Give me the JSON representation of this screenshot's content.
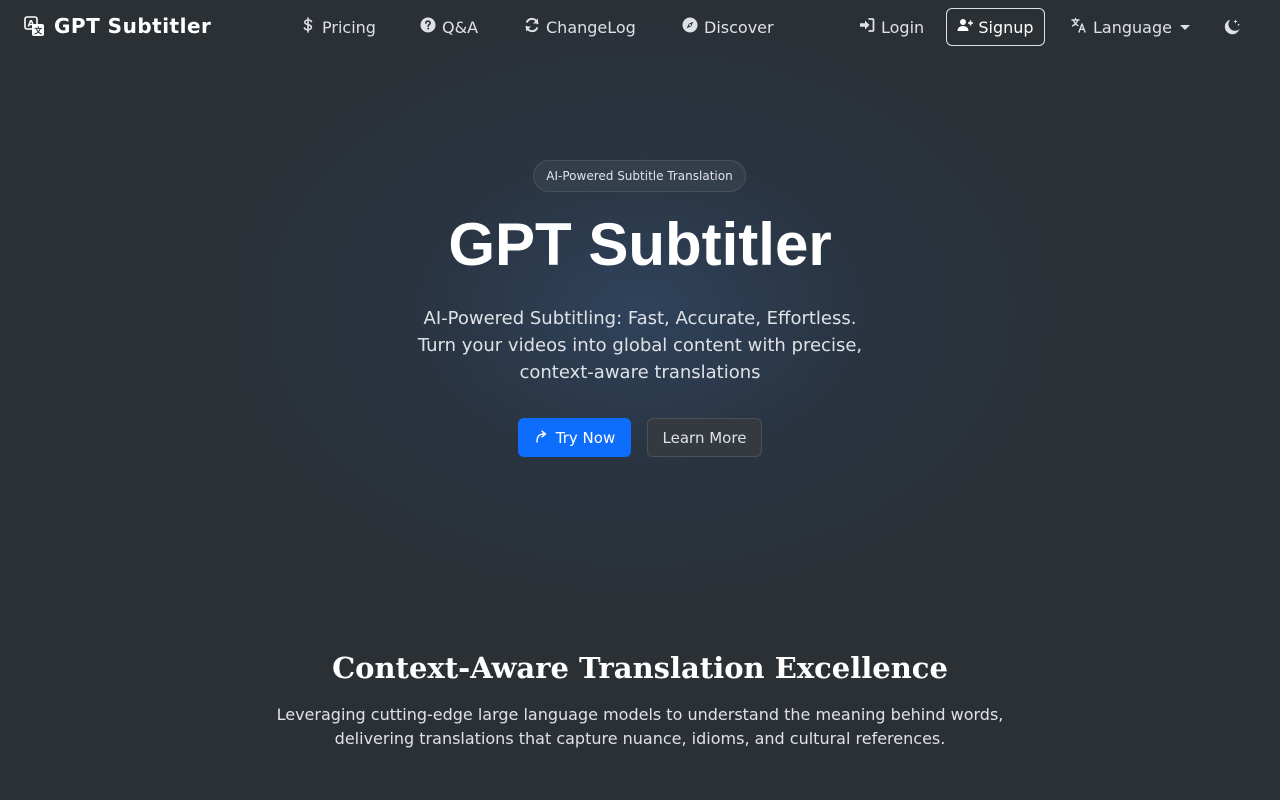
{
  "nav": {
    "brand": "GPT Subtitler",
    "brand_icon": "translate-icon",
    "links": [
      {
        "label": "Pricing",
        "icon": "dollar-icon"
      },
      {
        "label": "Q&A",
        "icon": "question-circle-icon"
      },
      {
        "label": "ChangeLog",
        "icon": "refresh-icon"
      },
      {
        "label": "Discover",
        "icon": "compass-icon"
      }
    ],
    "login": {
      "label": "Login",
      "icon": "sign-in-icon"
    },
    "signup": {
      "label": "Signup",
      "icon": "user-plus-icon"
    },
    "language": {
      "label": "Language",
      "icon": "language-icon"
    },
    "theme_icon": "moon-stars-icon"
  },
  "hero": {
    "badge": "AI-Powered Subtitle Translation",
    "title": "GPT Subtitler",
    "subtitle_lines": [
      "AI-Powered Subtitling: Fast, Accurate, Effortless.",
      "Turn your videos into global content with precise,",
      "context-aware translations"
    ],
    "try_now": "Try Now",
    "learn_more": "Learn More"
  },
  "section": {
    "title": "Context-Aware Translation Excellence",
    "text_lines": [
      "Leveraging cutting-edge large language models to understand the meaning behind words,",
      "delivering translations that capture nuance, idioms, and cultural references."
    ]
  },
  "colors": {
    "background": "#2b3035",
    "primary": "#0d6efd",
    "text": "#dee2e6",
    "heading": "#ffffff"
  }
}
